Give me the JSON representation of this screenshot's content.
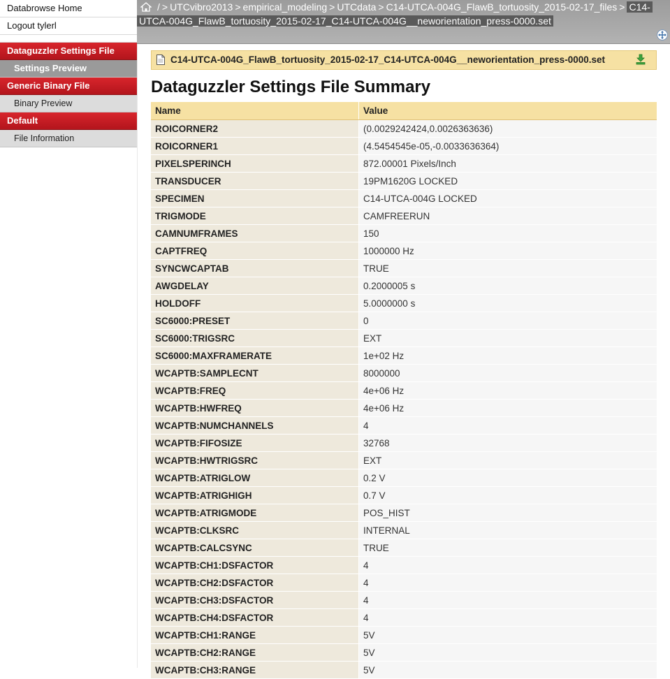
{
  "sidebar": {
    "top_links": [
      "Databrowse Home",
      "Logout tylerl"
    ],
    "sections": [
      {
        "title": "Dataguzzler Settings File",
        "items": [
          {
            "label": "Settings Preview",
            "active": true
          }
        ]
      },
      {
        "title": "Generic Binary File",
        "items": [
          {
            "label": "Binary Preview",
            "active": false
          }
        ]
      },
      {
        "title": "Default",
        "items": [
          {
            "label": "File Information",
            "active": false
          }
        ]
      }
    ]
  },
  "breadcrumb": {
    "root": "/",
    "items": [
      "UTCvibro2013",
      "empirical_modeling",
      "UTCdata",
      "C14-UTCA-004G_FlawB_tortuosity_2015-02-17_files"
    ],
    "current_part1": "C14-",
    "current_part2": "UTCA-004G_FlawB_tortuosity_2015-02-17_C14-UTCA-004G__neworientation_press-0000.set"
  },
  "file_bar": {
    "name": "C14-UTCA-004G_FlawB_tortuosity_2015-02-17_C14-UTCA-004G__neworientation_press-0000.set"
  },
  "summary": {
    "title": "Dataguzzler Settings File Summary",
    "columns": [
      "Name",
      "Value"
    ],
    "rows": [
      [
        "ROICORNER2",
        "(0.0029242424,0.0026363636)"
      ],
      [
        "ROICORNER1",
        "(4.5454545e-05,-0.0033636364)"
      ],
      [
        "PIXELSPERINCH",
        "872.00001 Pixels/Inch"
      ],
      [
        "TRANSDUCER",
        "19PM1620G LOCKED"
      ],
      [
        "SPECIMEN",
        "C14-UTCA-004G LOCKED"
      ],
      [
        "TRIGMODE",
        "CAMFREERUN"
      ],
      [
        "CAMNUMFRAMES",
        "150"
      ],
      [
        "CAPTFREQ",
        "1000000 Hz"
      ],
      [
        "SYNCWCAPTAB",
        "TRUE"
      ],
      [
        "AWGDELAY",
        "0.2000005 s"
      ],
      [
        "HOLDOFF",
        "5.0000000 s"
      ],
      [
        "SC6000:PRESET",
        "0"
      ],
      [
        "SC6000:TRIGSRC",
        "EXT"
      ],
      [
        "SC6000:MAXFRAMERATE",
        "1e+02 Hz"
      ],
      [
        "WCAPTB:SAMPLECNT",
        "8000000"
      ],
      [
        "WCAPTB:FREQ",
        "4e+06 Hz"
      ],
      [
        "WCAPTB:HWFREQ",
        "4e+06 Hz"
      ],
      [
        "WCAPTB:NUMCHANNELS",
        "4"
      ],
      [
        "WCAPTB:FIFOSIZE",
        "32768"
      ],
      [
        "WCAPTB:HWTRIGSRC",
        "EXT"
      ],
      [
        "WCAPTB:ATRIGLOW",
        "0.2 V"
      ],
      [
        "WCAPTB:ATRIGHIGH",
        "0.7 V"
      ],
      [
        "WCAPTB:ATRIGMODE",
        "POS_HIST"
      ],
      [
        "WCAPTB:CLKSRC",
        "INTERNAL"
      ],
      [
        "WCAPTB:CALCSYNC",
        "TRUE"
      ],
      [
        "WCAPTB:CH1:DSFACTOR",
        "4"
      ],
      [
        "WCAPTB:CH2:DSFACTOR",
        "4"
      ],
      [
        "WCAPTB:CH3:DSFACTOR",
        "4"
      ],
      [
        "WCAPTB:CH4:DSFACTOR",
        "4"
      ],
      [
        "WCAPTB:CH1:RANGE",
        "5V"
      ],
      [
        "WCAPTB:CH2:RANGE",
        "5V"
      ],
      [
        "WCAPTB:CH3:RANGE",
        "5V"
      ]
    ]
  },
  "icons": {
    "home": "home-icon",
    "file": "file-icon",
    "download": "download-icon",
    "expand": "expand-arrows-icon"
  },
  "colors": {
    "section_red": "#c81e25",
    "header_gray": "#a9a9a9",
    "table_header": "#f6e1a3"
  }
}
